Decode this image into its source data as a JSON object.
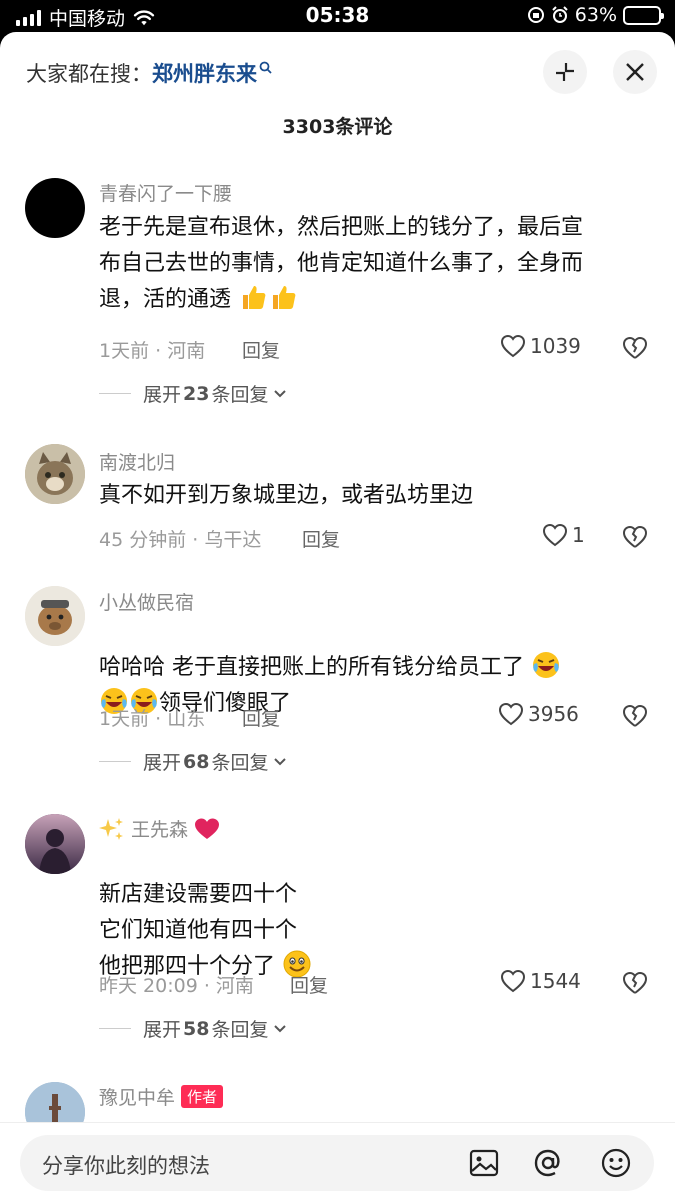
{
  "status_bar": {
    "carrier": "中国移动",
    "time": "05:38",
    "battery": "63%",
    "battery_level": 0.63
  },
  "header": {
    "hot_search_label": "大家都在搜：",
    "hot_search_term": "郑州胖东来",
    "comment_count": "3303条评论"
  },
  "comments": [
    {
      "username": "青春闪了一下腰",
      "lines": [
        "老于先是宣布退休，然后把账上的钱分了，最后宣",
        "布自己去世的事情，他肯定知道什么事了，全身而",
        "退，活的通透"
      ],
      "emojis": [
        "thumbs-up-emoji",
        "thumbs-up-emoji"
      ],
      "meta": "1天前 · 河南",
      "reply_label": "回复",
      "likes": "1039",
      "expand_prefix": "展开",
      "expand_count": "23",
      "expand_suffix": "条回复"
    },
    {
      "username": "南渡北归",
      "lines": [
        "真不如开到万象城里边，或者弘坊里边"
      ],
      "meta": "45 分钟前 · 乌干达",
      "reply_label": "回复",
      "likes": "1"
    },
    {
      "username": "小丛做民宿",
      "lines": [
        "哈哈哈  老于直接把账上的所有钱分给员工了",
        "领导们傻眼了"
      ],
      "emojis": [
        "laughing-crying-emoji",
        "laughing-crying-emoji",
        "laughing-crying-emoji"
      ],
      "meta": "1天前 · 山东",
      "reply_label": "回复",
      "likes": "3956",
      "expand_prefix": "展开",
      "expand_count": "68",
      "expand_suffix": "条回复"
    },
    {
      "username": "王先森",
      "lines": [
        "新店建设需要四十个",
        "它们知道他有四十个",
        "他把那四十个分了"
      ],
      "emojis": [
        "sparkles-emoji",
        "red-heart-emoji",
        "grinning-emoji"
      ],
      "meta": "昨天 20:09 · 河南",
      "reply_label": "回复",
      "likes": "1544",
      "expand_prefix": "展开",
      "expand_count": "58",
      "expand_suffix": "条回复"
    },
    {
      "username": "豫见中牟",
      "badge": "作者"
    }
  ],
  "input": {
    "placeholder": "分享你此刻的想法"
  },
  "icons": {
    "image": "image-icon",
    "mention": "at-icon",
    "emoji": "emoji-icon",
    "like": "heart-outline-icon",
    "dislike": "broken-heart-icon"
  }
}
